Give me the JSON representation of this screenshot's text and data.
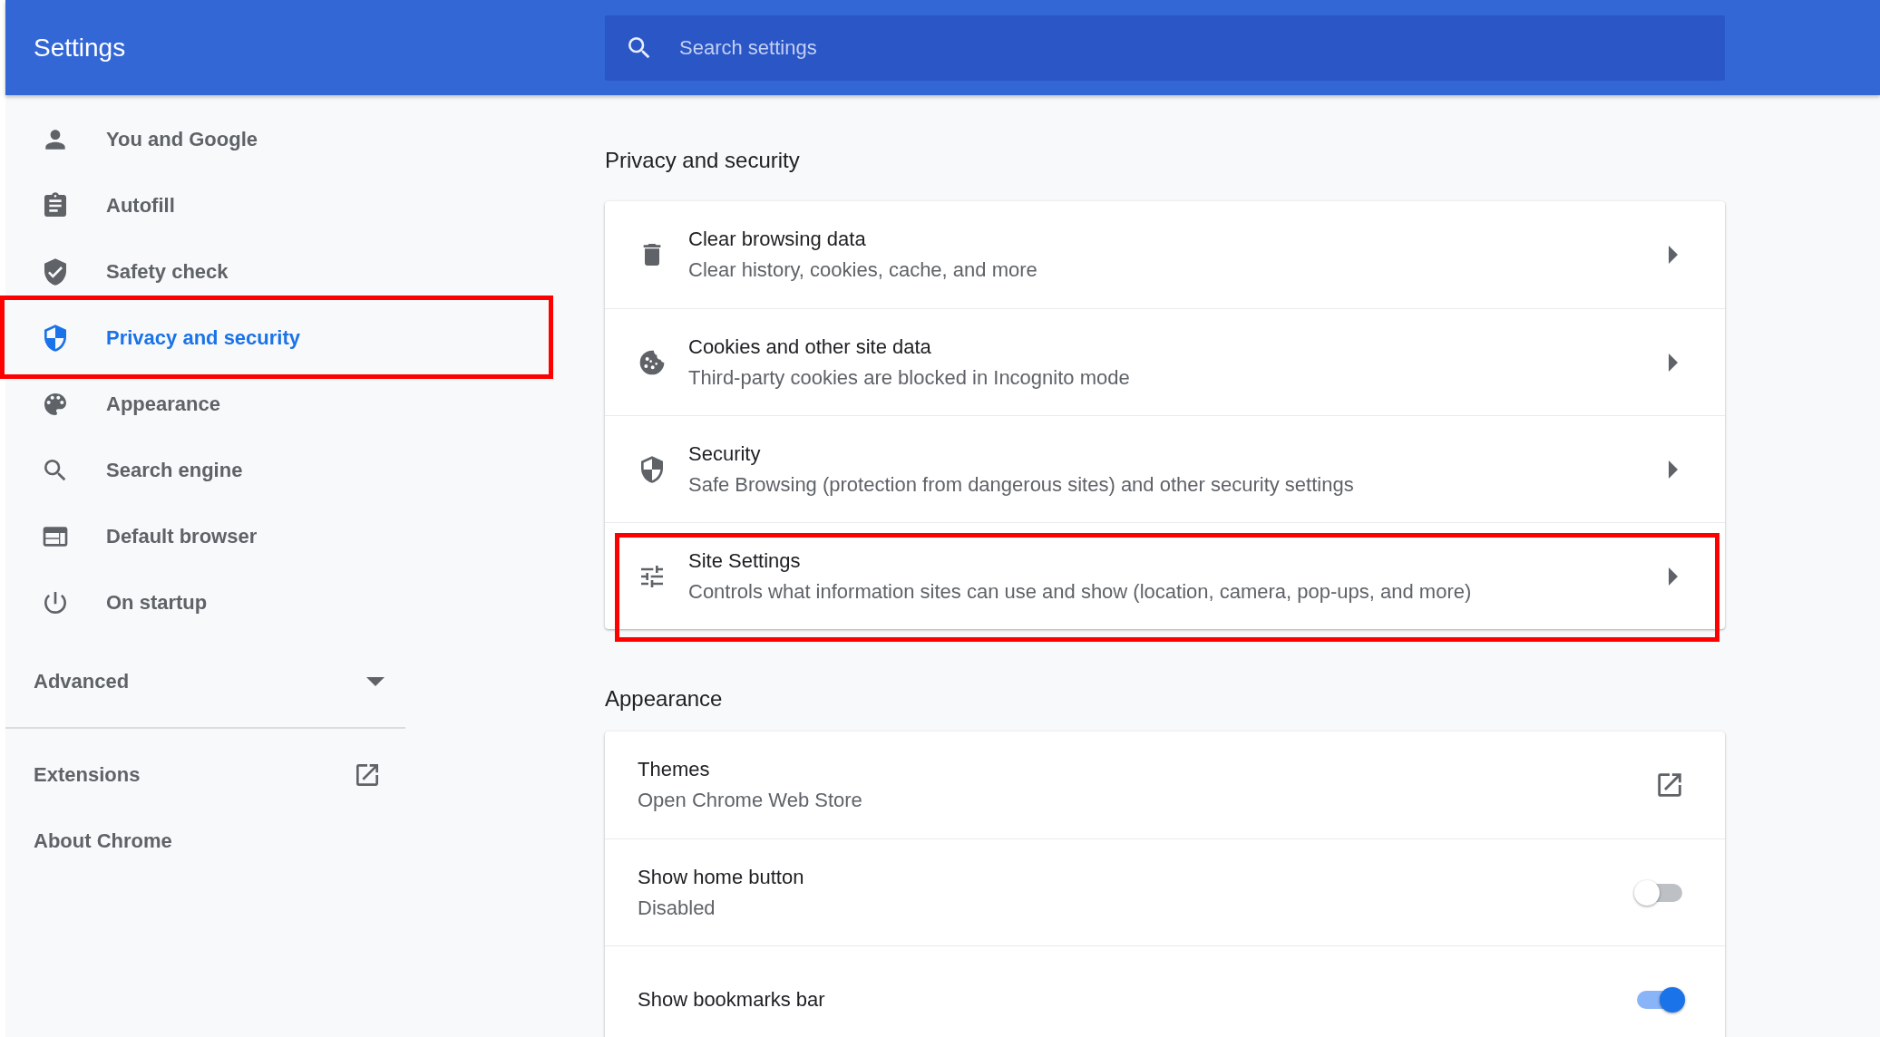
{
  "header": {
    "title": "Settings",
    "search": {
      "placeholder": "Search settings"
    }
  },
  "sidebar": {
    "items": [
      {
        "label": "You and Google",
        "selected": false,
        "highlighted": false
      },
      {
        "label": "Autofill",
        "selected": false,
        "highlighted": false
      },
      {
        "label": "Safety check",
        "selected": false,
        "highlighted": false
      },
      {
        "label": "Privacy and security",
        "selected": true,
        "highlighted": true
      },
      {
        "label": "Appearance",
        "selected": false,
        "highlighted": false
      },
      {
        "label": "Search engine",
        "selected": false,
        "highlighted": false
      },
      {
        "label": "Default browser",
        "selected": false,
        "highlighted": false
      },
      {
        "label": "On startup",
        "selected": false,
        "highlighted": false
      }
    ],
    "advanced": {
      "label": "Advanced",
      "expanded": false
    },
    "links": [
      {
        "label": "Extensions",
        "external": true
      },
      {
        "label": "About Chrome",
        "external": false
      }
    ]
  },
  "sections": [
    {
      "title": "Privacy and security",
      "rows": [
        {
          "kind": "link",
          "title": "Clear browsing data",
          "subtitle": "Clear history, cookies, cache, and more",
          "highlighted": false
        },
        {
          "kind": "link",
          "title": "Cookies and other site data",
          "subtitle": "Third-party cookies are blocked in Incognito mode",
          "highlighted": false
        },
        {
          "kind": "link",
          "title": "Security",
          "subtitle": "Safe Browsing (protection from dangerous sites) and other security settings",
          "highlighted": false
        },
        {
          "kind": "link",
          "title": "Site Settings",
          "subtitle": "Controls what information sites can use and show (location, camera, pop-ups, and more)",
          "highlighted": true
        }
      ]
    },
    {
      "title": "Appearance",
      "rows": [
        {
          "kind": "external",
          "title": "Themes",
          "subtitle": "Open Chrome Web Store"
        },
        {
          "kind": "toggle",
          "title": "Show home button",
          "subtitle": "Disabled",
          "on": false
        },
        {
          "kind": "toggle",
          "title": "Show bookmarks bar",
          "on": true
        }
      ]
    }
  ]
}
